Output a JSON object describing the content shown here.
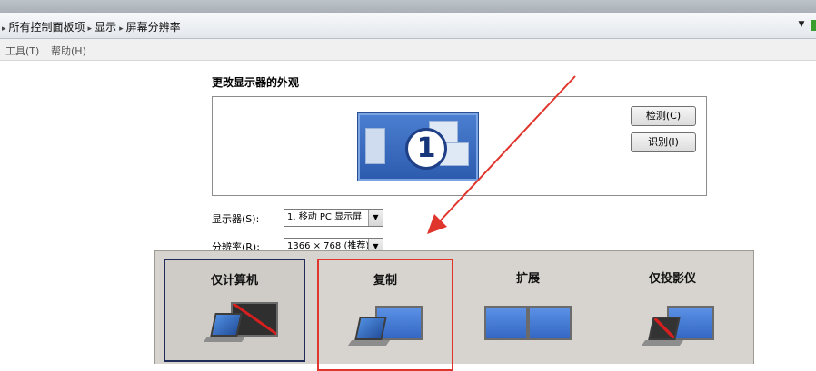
{
  "address_bar": {
    "breadcrumbs": [
      "所有控制面板项",
      "显示",
      "屏幕分辨率"
    ]
  },
  "menubar": {
    "items": [
      "工具(T)",
      "帮助(H)"
    ]
  },
  "main": {
    "heading": "更改显示器的外观",
    "monitor_number": "1",
    "detect_button": "检测(C)",
    "identify_button": "识别(I)",
    "display_label": "显示器(S):",
    "display_value": "1. 移动 PC 显示屏",
    "resolution_label": "分辨率(R):",
    "resolution_value": "1366 × 768 (推荐)"
  },
  "projection_switcher": {
    "options": [
      {
        "label": "仅计算机",
        "icon": "computer-only-icon",
        "selected": true
      },
      {
        "label": "复制",
        "icon": "duplicate-icon",
        "highlighted": true
      },
      {
        "label": "扩展",
        "icon": "extend-icon"
      },
      {
        "label": "仅投影仪",
        "icon": "projector-only-icon"
      }
    ]
  },
  "colors": {
    "annotation": "#e0352c",
    "selection_border": "#1f2c5a",
    "switcher_bg": "#d7d4cf"
  }
}
